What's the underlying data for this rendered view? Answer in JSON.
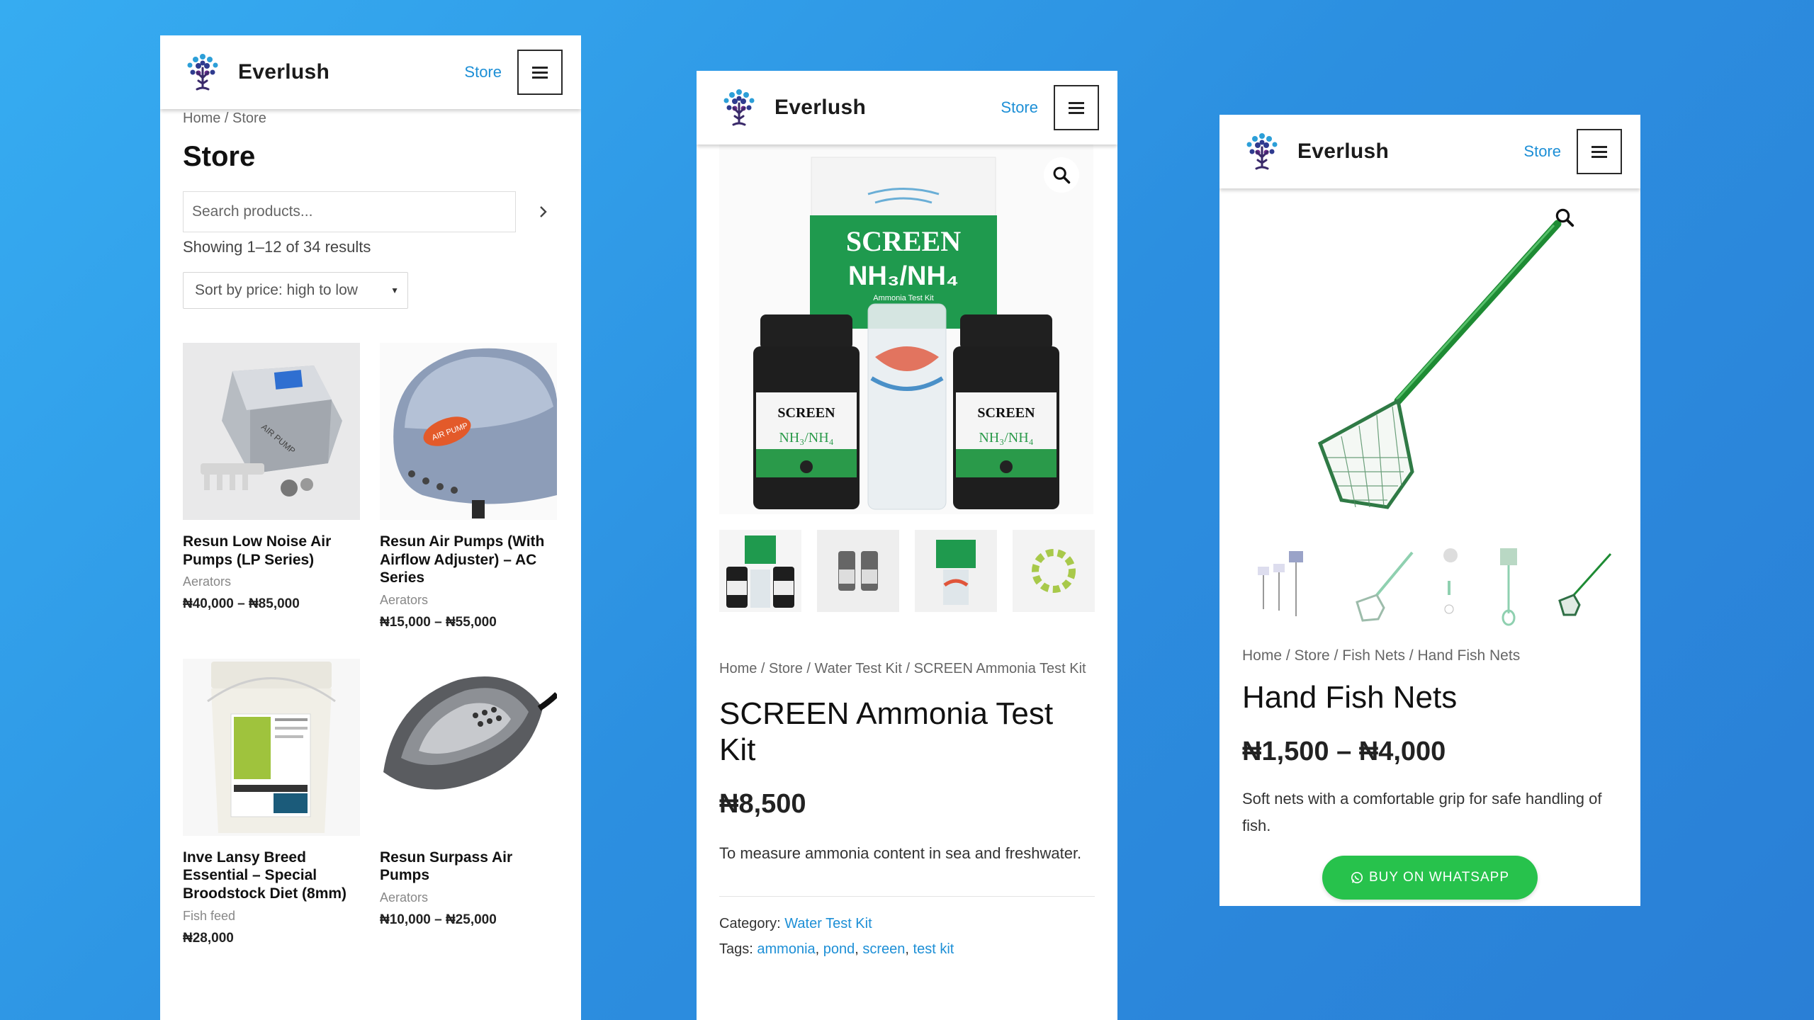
{
  "brand": {
    "name": "Everlush",
    "store_link": "Store"
  },
  "store_page": {
    "breadcrumb": {
      "home": "Home",
      "sep": " / ",
      "current": "Store"
    },
    "title": "Store",
    "search": {
      "placeholder": "Search products..."
    },
    "result_count": "Showing 1–12 of 34 results",
    "sort": {
      "selected": "Sort by price: high to low"
    },
    "products": [
      {
        "name": "Resun Low Noise Air Pumps (LP Series)",
        "category": "Aerators",
        "price": "₦40,000 – ₦85,000"
      },
      {
        "name": "Resun Air Pumps (With Airflow Adjuster) – AC Series",
        "category": "Aerators",
        "price": "₦15,000 – ₦55,000"
      },
      {
        "name": "Inve Lansy Breed Essential – Special Broodstock Diet (8mm)",
        "category": "Fish feed",
        "price": "₦28,000"
      },
      {
        "name": "Resun Surpass Air Pumps",
        "category": "Aerators",
        "price": "₦10,000 – ₦25,000"
      }
    ]
  },
  "product_page_1": {
    "image_text": {
      "brand": "SCREEN",
      "formula": "NH₃/NH₄",
      "subtitle": "Ammonia Test Kit"
    },
    "breadcrumb": {
      "home": "Home",
      "store": "Store",
      "category": "Water Test Kit",
      "current": "SCREEN Ammonia Test Kit"
    },
    "title": "SCREEN Ammonia Test Kit",
    "price": "₦8,500",
    "description": "To measure ammonia content in sea and freshwater.",
    "category_label": "Category:",
    "category": "Water Test Kit",
    "tags_label": "Tags:",
    "tags": [
      "ammonia",
      "pond",
      "screen",
      "test kit"
    ]
  },
  "product_page_2": {
    "breadcrumb": {
      "home": "Home",
      "store": "Store",
      "category": "Fish Nets",
      "current": "Hand Fish Nets"
    },
    "title": "Hand Fish Nets",
    "price": "₦1,500 – ₦4,000",
    "description": "Soft nets with a comfortable grip for safe handling of fish.",
    "whatsapp_label": "BUY ON WHATSAPP"
  },
  "colors": {
    "link": "#1d8fd6",
    "whatsapp": "#27c24c",
    "background": "#2c8fe0"
  }
}
